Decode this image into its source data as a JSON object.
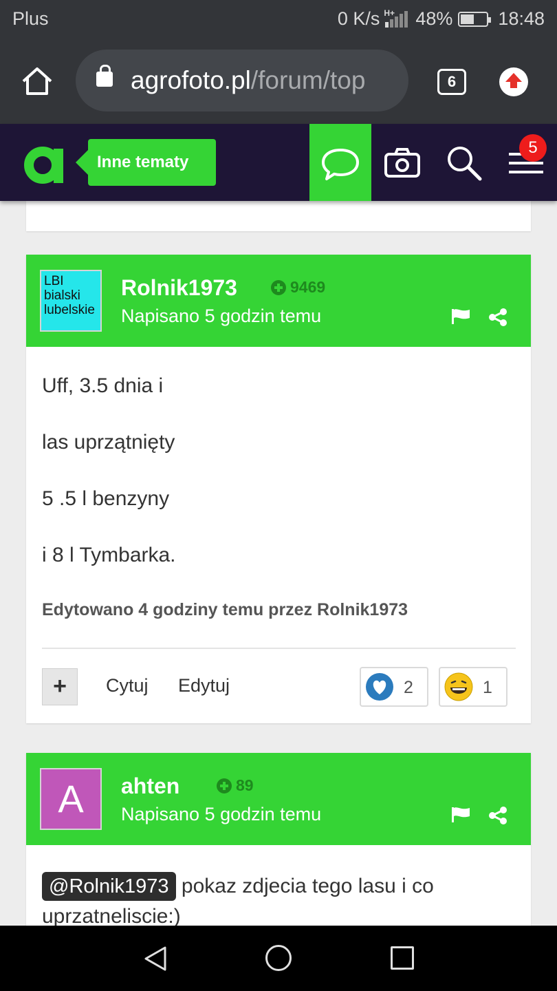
{
  "status_bar": {
    "carrier": "Plus",
    "speed": "0 K/s",
    "network": "H+",
    "battery": "48%",
    "battery_level": 0.48,
    "time": "18:48"
  },
  "browser": {
    "url_domain": "agrofoto.pl",
    "url_path": "/forum/top",
    "tab_count": "6"
  },
  "site_header": {
    "section_label": "Inne tematy",
    "menu_badge": "5",
    "icons": [
      "chat-icon",
      "camera-icon",
      "search-icon",
      "menu-icon"
    ],
    "accent_color": "#35d435",
    "header_bg": "#1e1536"
  },
  "posts": [
    {
      "avatar_text": [
        "LBI",
        "bialski",
        "lubelskie"
      ],
      "author": "Rolnik1973",
      "reputation": "9469",
      "time": "Napisano 5 godzin temu",
      "paragraphs": [
        "Uff,  3.5 dnia i",
        "las uprzątnięty",
        "5 .5 l benzyny",
        "i 8 l Tymbarka."
      ],
      "edited": "Edytowano 4 godziny temu przez Rolnik1973",
      "actions": {
        "plus": "+",
        "quote": "Cytuj",
        "edit": "Edytuj"
      },
      "reactions": [
        {
          "icon": "heart-icon",
          "count": "2"
        },
        {
          "icon": "laugh-icon",
          "count": "1"
        }
      ]
    },
    {
      "avatar_text": "A",
      "author": "ahten",
      "reputation": "89",
      "time": "Napisano 5 godzin temu",
      "mention": "@Rolnik1973",
      "text": "pokaz zdjecia tego lasu i co",
      "text_cont": "uprzatneliscie:)"
    }
  ]
}
